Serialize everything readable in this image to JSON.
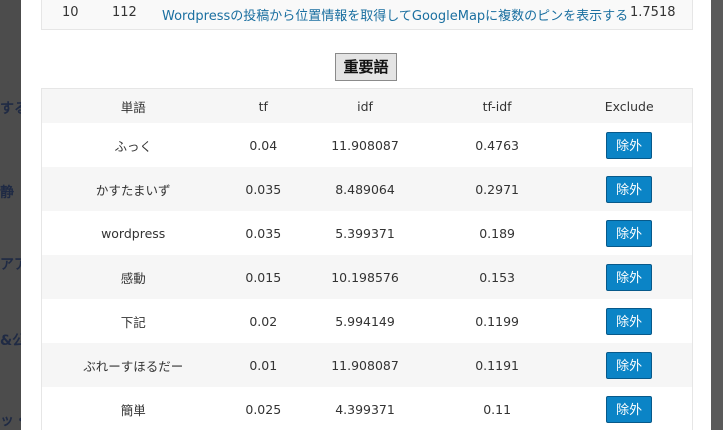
{
  "backdrop": {
    "fragments": [
      "する",
      "静",
      "アア",
      "&公",
      "ッ・"
    ]
  },
  "top_result_row": {
    "rank": "10",
    "id": "112",
    "title": "Wordpressの投稿から位置情報を取得してGoogleMapに複数のピンを表示する",
    "score": "1.7518"
  },
  "heading_button": "重要語",
  "table": {
    "headers": [
      "単語",
      "tf",
      "idf",
      "tf-idf",
      "Exclude"
    ],
    "exclude_label": "除外",
    "rows": [
      {
        "word": "ふっく",
        "tf": "0.04",
        "idf": "11.908087",
        "tfidf": "0.4763"
      },
      {
        "word": "かすたまいず",
        "tf": "0.035",
        "idf": "8.489064",
        "tfidf": "0.2971"
      },
      {
        "word": "wordpress",
        "tf": "0.035",
        "idf": "5.399371",
        "tfidf": "0.189"
      },
      {
        "word": "感動",
        "tf": "0.015",
        "idf": "10.198576",
        "tfidf": "0.153"
      },
      {
        "word": "下記",
        "tf": "0.02",
        "idf": "5.994149",
        "tfidf": "0.1199"
      },
      {
        "word": "ぶれーすほるだー",
        "tf": "0.01",
        "idf": "11.908087",
        "tfidf": "0.1191"
      },
      {
        "word": "簡単",
        "tf": "0.025",
        "idf": "4.399371",
        "tfidf": "0.11"
      }
    ]
  },
  "colors": {
    "accent": "#0b84c6",
    "link": "#1a6fa0",
    "overlay": "#4c4c4c"
  }
}
